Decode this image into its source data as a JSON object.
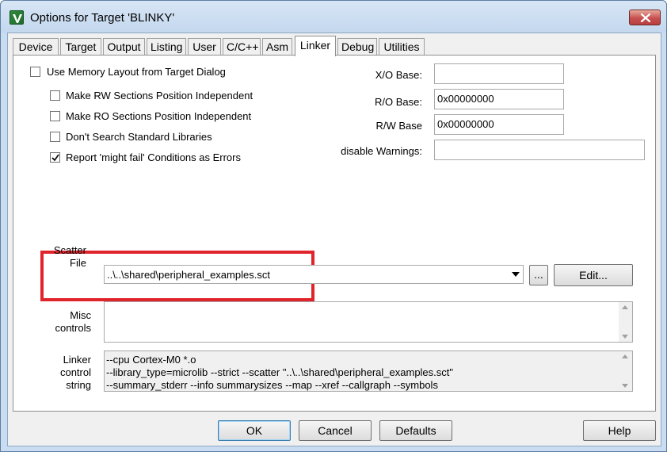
{
  "window": {
    "title": "Options for Target 'BLINKY'",
    "app_icon": "keil-uvision-icon",
    "close_icon": "close-icon"
  },
  "tabs": [
    {
      "label": "Device",
      "active": false
    },
    {
      "label": "Target",
      "active": false
    },
    {
      "label": "Output",
      "active": false
    },
    {
      "label": "Listing",
      "active": false
    },
    {
      "label": "User",
      "active": false
    },
    {
      "label": "C/C++",
      "active": false
    },
    {
      "label": "Asm",
      "active": false
    },
    {
      "label": "Linker",
      "active": true
    },
    {
      "label": "Debug",
      "active": false
    },
    {
      "label": "Utilities",
      "active": false
    }
  ],
  "options": {
    "use_memory_layout": {
      "label": "Use Memory Layout from Target Dialog",
      "checked": false
    },
    "rw_independent": {
      "label": "Make RW Sections Position Independent",
      "checked": false
    },
    "ro_independent": {
      "label": "Make RO Sections Position Independent",
      "checked": false
    },
    "dont_search_libs": {
      "label": "Don't Search Standard Libraries",
      "checked": false
    },
    "might_fail_errors": {
      "label": "Report 'might fail' Conditions as Errors",
      "checked": true
    }
  },
  "fields": {
    "xo_base": {
      "label": "X/O Base:",
      "value": ""
    },
    "ro_base": {
      "label": "R/O Base:",
      "value": "0x00000000"
    },
    "rw_base": {
      "label": "R/W Base",
      "value": "0x00000000"
    },
    "disable_warnings": {
      "label": "disable Warnings:",
      "value": ""
    }
  },
  "scatter": {
    "label_line1": "Scatter",
    "label_line2": "File",
    "value": "..\\..\\shared\\peripheral_examples.sct",
    "browse_label": "...",
    "edit_label": "Edit..."
  },
  "misc": {
    "label_line1": "Misc",
    "label_line2": "controls",
    "value": ""
  },
  "linker_string": {
    "label_line1": "Linker",
    "label_line2": "control",
    "label_line3": "string",
    "lines": [
      "--cpu Cortex-M0 *.o",
      "--library_type=microlib --strict --scatter \"..\\..\\shared\\peripheral_examples.sct\"",
      "--summary_stderr --info summarysizes --map --xref --callgraph --symbols"
    ]
  },
  "buttons": {
    "ok": "OK",
    "cancel": "Cancel",
    "defaults": "Defaults",
    "help": "Help"
  },
  "colors": {
    "highlight_box": "#e0242b",
    "close_button": "#c75050",
    "window_frame": "#c9dcf1"
  }
}
